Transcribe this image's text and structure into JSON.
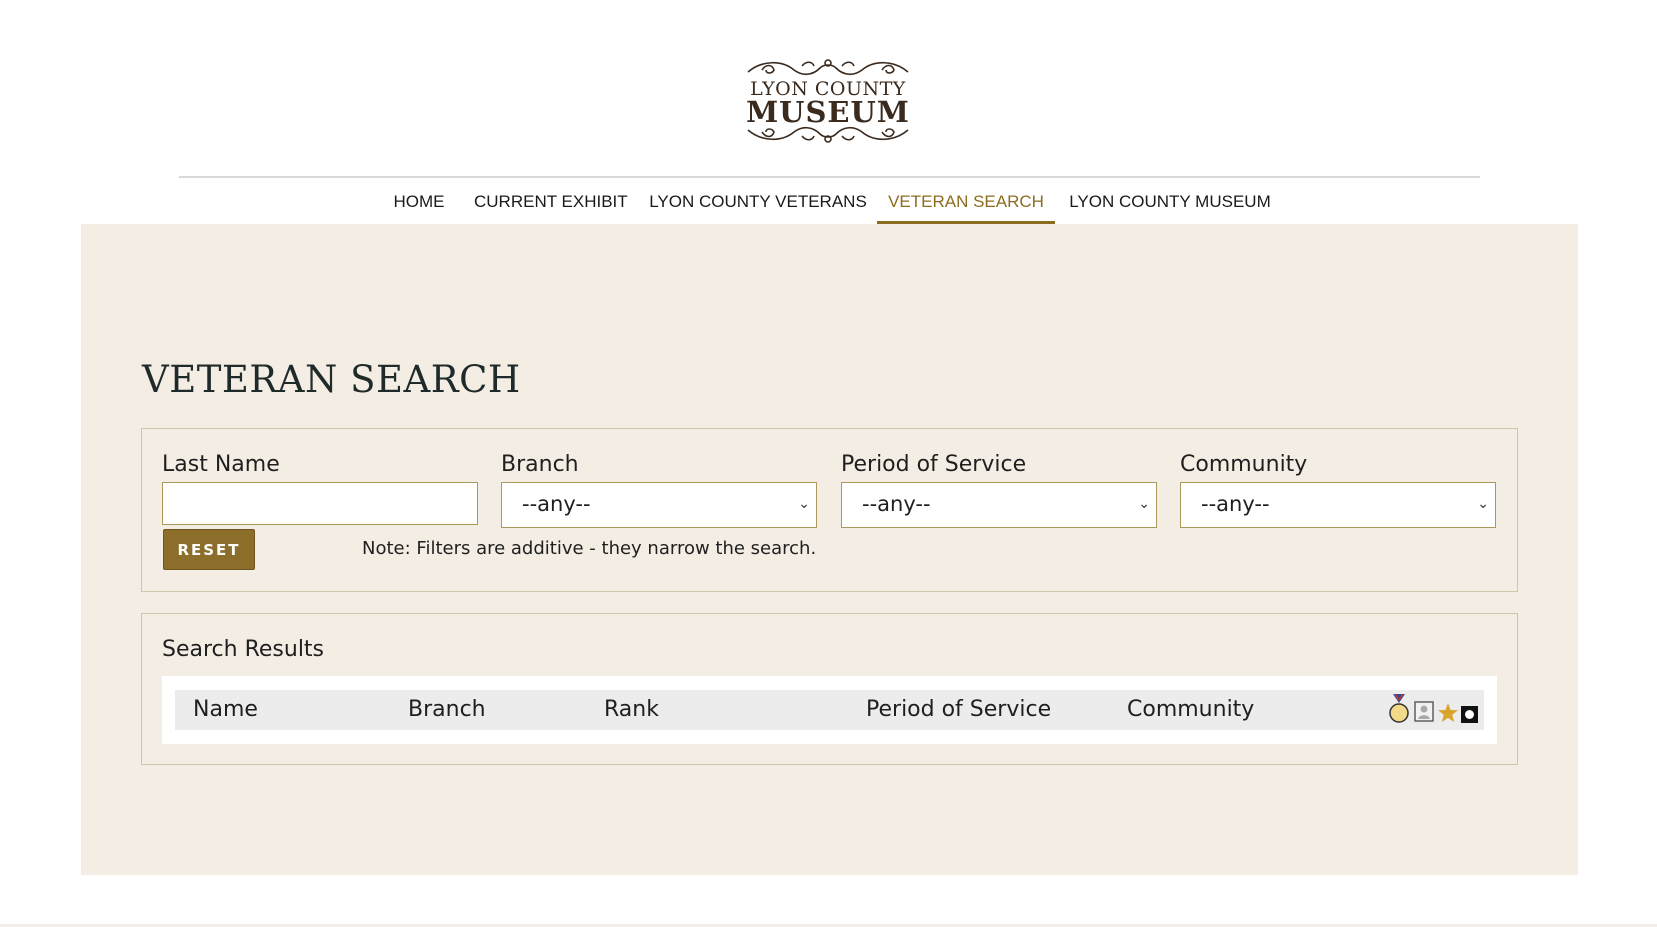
{
  "logo": {
    "line1": "LYON COUNTY",
    "line2": "MUSEUM"
  },
  "nav": {
    "items": [
      {
        "label": "HOME"
      },
      {
        "label": "CURRENT EXHIBIT"
      },
      {
        "label": "LYON COUNTY VETERANS"
      },
      {
        "label": "VETERAN SEARCH",
        "active": true
      },
      {
        "label": "LYON COUNTY MUSEUM"
      }
    ]
  },
  "page": {
    "title": "VETERAN SEARCH"
  },
  "filters": {
    "last_name": {
      "label": "Last Name",
      "value": "",
      "placeholder": ""
    },
    "branch": {
      "label": "Branch",
      "selected": "--any--"
    },
    "period": {
      "label": "Period of Service",
      "selected": "--any--"
    },
    "community": {
      "label": "Community",
      "selected": "--any--"
    },
    "reset_label": "RESET",
    "note": "Note: Filters are additive - they narrow the search."
  },
  "results": {
    "title": "Search Results",
    "columns": [
      "Name",
      "Branch",
      "Rank",
      "Period of Service",
      "Community"
    ],
    "icons": [
      "medal-icon",
      "portrait-icon",
      "star-icon",
      "square-badge-icon"
    ]
  },
  "colors": {
    "accent": "#8c6d1f",
    "panel_bg": "#f4ede3",
    "button_bg": "#8c6d2a"
  }
}
